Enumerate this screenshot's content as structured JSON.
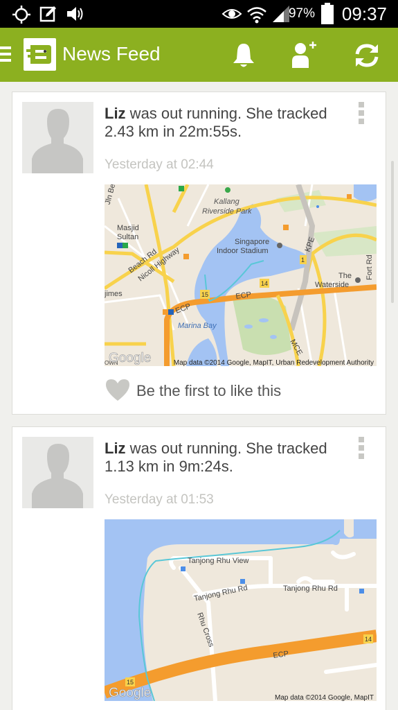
{
  "status_bar": {
    "battery_percent": "97%",
    "time": "09:37",
    "icons": [
      "gps-icon",
      "edit-notification-icon",
      "volume-icon",
      "eye-icon",
      "wifi-icon",
      "signal-icon",
      "battery-icon"
    ]
  },
  "app_bar": {
    "title": "News Feed",
    "icons": [
      "menu-icon",
      "app-logo-icon",
      "bell-icon",
      "add-friend-icon",
      "refresh-icon"
    ],
    "accent_color": "#8cb020"
  },
  "feed": [
    {
      "user": "Liz",
      "message": " was out running. She tracked 2.43 km in 22m:55s.",
      "timestamp": "Yesterday at 02:44",
      "like_text": "Be the first to like this",
      "map": {
        "attribution": "Map data ©2014 Google, MapIT, Urban Redevelopment Authority",
        "logo": "Google",
        "labels": {
          "kallang": "Kallang",
          "riverside": "Riverside Park",
          "masjid": "Masjid",
          "sultan": "Sultan",
          "singapore": "Singapore",
          "indoor": "Indoor Stadium",
          "beach_rd": "Beach Rd",
          "nicoll": "Nicoll Highway",
          "kpe": "KPE",
          "fort": "Fort Rd",
          "the": "The",
          "waterside": "Waterside",
          "jimes": "jimes",
          "ecp1": "ECP",
          "ecp2": "ECP",
          "marina": "Marina Bay",
          "mce": "MCE",
          "jln": "Jln Be",
          "own": "OWN",
          "n15": "15",
          "n14": "14",
          "n1": "1"
        }
      }
    },
    {
      "user": "Liz",
      "message": " was out running. She tracked 1.13 km in 9m:24s.",
      "timestamp": "Yesterday at 01:53",
      "map": {
        "attribution": "Map data ©2014 Google, MapIT",
        "logo": "Google",
        "labels": {
          "tanjong_view": "Tanjong Rhu View",
          "tanjong_rd1": "Tanjong Rhu Rd",
          "tanjong_rd2": "Tanjong Rhu Rd",
          "rhu_cross": "Rhu Cross",
          "ecp": "ECP",
          "n14": "14",
          "n15": "15"
        }
      }
    }
  ]
}
